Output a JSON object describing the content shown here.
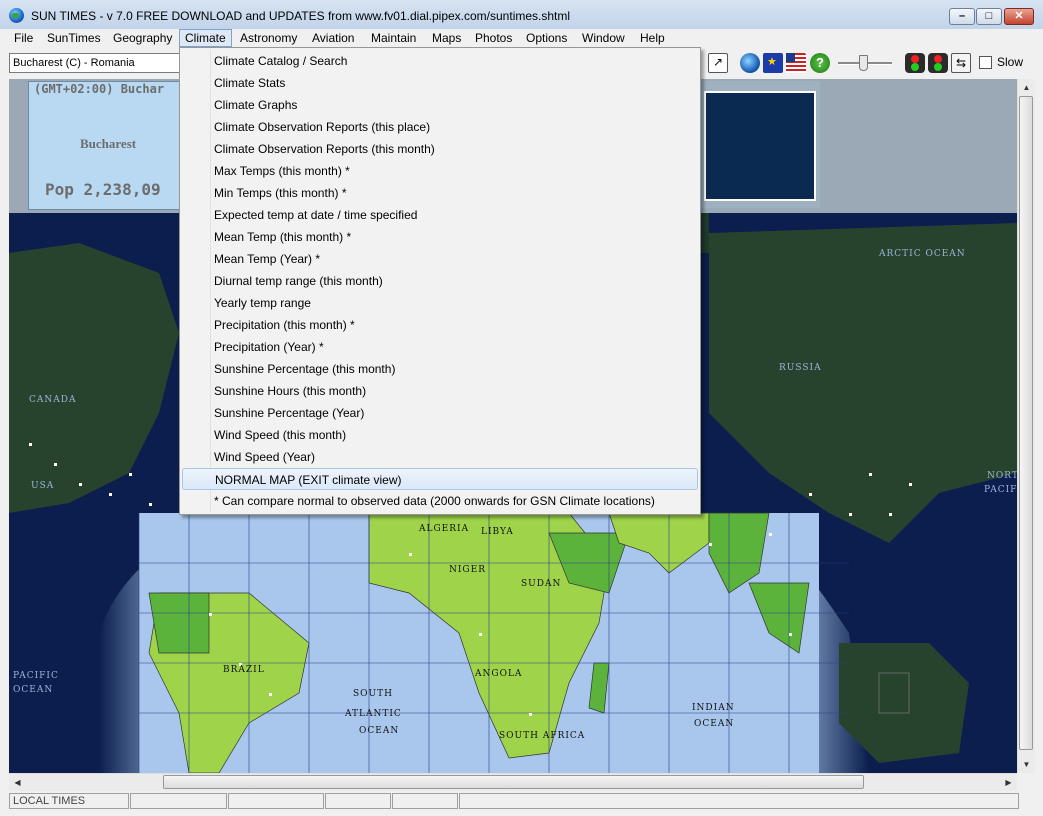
{
  "window": {
    "title": "SUN TIMES  -  v 7.0 FREE DOWNLOAD and UPDATES from www.fv01.dial.pipex.com/suntimes.shtml",
    "minimize_glyph": "–",
    "maximize_glyph": "□",
    "close_glyph": "✕"
  },
  "menubar": {
    "items": [
      "File",
      "SunTimes",
      "Geography",
      "Climate",
      "Astronomy",
      "Aviation",
      "Maintain",
      "Maps",
      "Photos",
      "Options",
      "Window",
      "Help"
    ],
    "active": "Climate"
  },
  "toolbar": {
    "place_value": "Bucharest (C) - Romania",
    "help_glyph": "?",
    "swap_glyph": "⇆",
    "slow_label": "Slow",
    "slow_checked": false
  },
  "info": {
    "timezone": "(GMT+02:00) Buchar",
    "city": "Bucharest",
    "population": "Pop 2,238,09"
  },
  "climate_menu": {
    "items": [
      "Climate Catalog / Search",
      "Climate Stats",
      "Climate Graphs",
      "Climate Observation Reports (this place)",
      "Climate Observation Reports (this month)",
      "Max Temps (this month) *",
      "Min Temps (this month) *",
      "Expected temp at date / time specified",
      "Mean Temp (this month) *",
      "Mean Temp (Year) *",
      "Diurnal temp range (this month)",
      "Yearly temp range",
      "Precipitation (this month) *",
      "Precipitation (Year) *",
      "Sunshine Percentage (this month)",
      "Sunshine Hours (this month)",
      "Sunshine Percentage (Year)",
      "Wind Speed (this month)",
      "Wind Speed (Year)",
      "NORMAL MAP (EXIT climate view)",
      "* Can compare normal to observed data (2000 onwards for GSN Climate locations)"
    ],
    "highlighted": "NORMAL MAP (EXIT climate view)"
  },
  "map_labels": {
    "canada": "CANADA",
    "arctic_ocean": "ARCTIC OCEAN",
    "russia": "RUSSIA",
    "north_pacific": "NORTH",
    "pacific": "PACIFIC",
    "south_pacific": "PACIFIC",
    "ocean_w": "OCEAN",
    "brazil": "BRAZIL",
    "south_atlantic_1": "SOUTH",
    "south_atlantic_2": "ATLANTIC",
    "south_atlantic_3": "OCEAN",
    "algeria": "ALGERIA",
    "libya": "LIBYA",
    "niger": "NIGER",
    "sudan": "SUDAN",
    "angola": "ANGOLA",
    "south_africa": "SOUTH AFRICA",
    "indian_ocean_1": "INDIAN",
    "indian_ocean_2": "OCEAN",
    "usa_short": "USA",
    "colors": {
      "land": "#5cb33c",
      "land_light": "#9fd44a",
      "ocean": "#a9c7ec",
      "night": "#0b1e4d",
      "night_land": "#27432e"
    }
  },
  "statusbar": {
    "cells": [
      "LOCAL TIMES",
      "",
      "",
      "",
      "",
      ""
    ]
  }
}
